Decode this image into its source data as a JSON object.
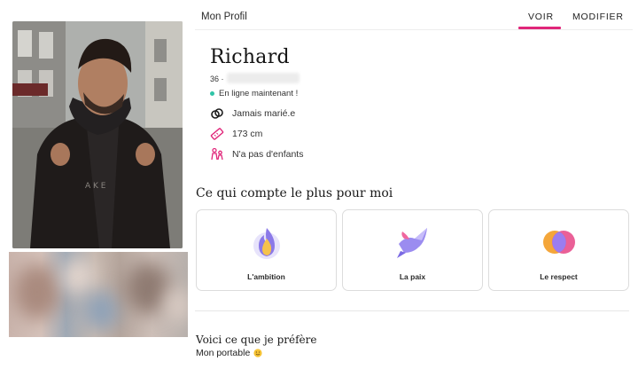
{
  "header": {
    "title": "Mon Profil",
    "tabs": [
      {
        "label": "VOIR",
        "active": true
      },
      {
        "label": "MODIFIER",
        "active": false
      }
    ],
    "accent_color": "#e0267a"
  },
  "profile": {
    "name": "Richard",
    "age": "36 ·",
    "status": "En ligne maintenant !",
    "status_color": "#2fc4a7",
    "attributes": [
      {
        "icon": "rings-icon",
        "label": "Jamais marié.e"
      },
      {
        "icon": "ruler-icon",
        "label": "173 cm"
      },
      {
        "icon": "kids-icon",
        "label": "N'a pas d'enfants"
      }
    ]
  },
  "values_section": {
    "title": "Ce qui compte le plus pour moi",
    "cards": [
      {
        "icon": "flame-icon",
        "label": "L'ambition"
      },
      {
        "icon": "dove-icon",
        "label": "La paix"
      },
      {
        "icon": "circles-icon",
        "label": "Le respect"
      }
    ]
  },
  "preferences": {
    "title": "Voici ce que je préfère",
    "value": "Mon portable",
    "emoji": "smiley-emoji"
  }
}
